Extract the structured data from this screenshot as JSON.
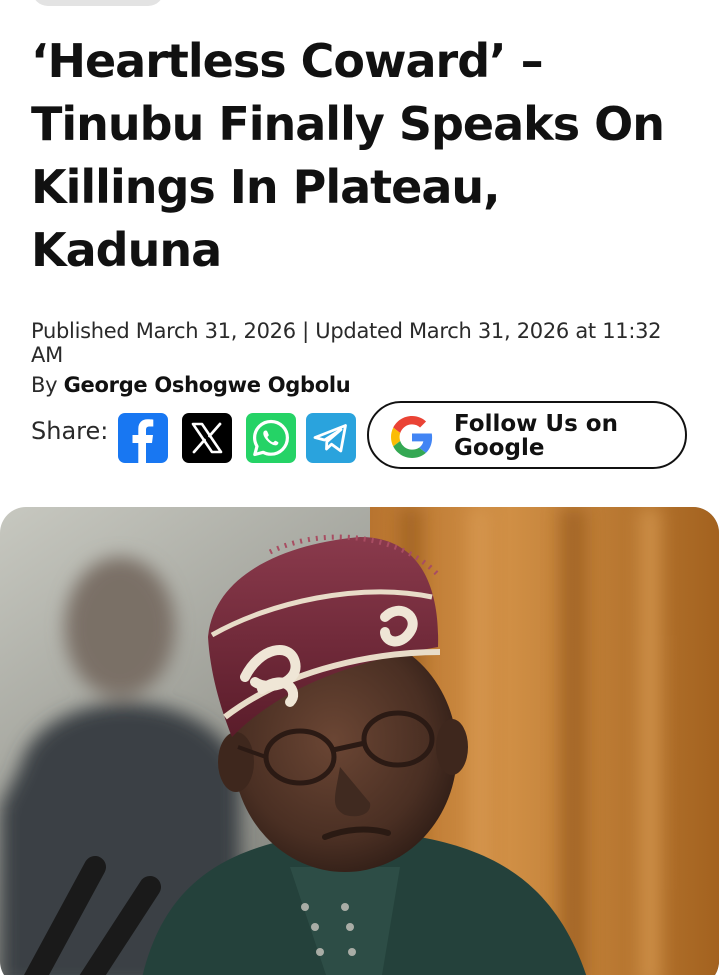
{
  "article": {
    "headline": "‘Heartless Coward’ – Tinubu Finally Speaks On Killings In Plateau, Kaduna",
    "published_line": "Published March 31, 2026 | Updated March 31, 2026 at 11:32 AM",
    "byline_prefix": "By ",
    "author": "George Oshogwe Ogbolu"
  },
  "share": {
    "label": "Share:",
    "networks": [
      {
        "name": "facebook",
        "icon": "facebook-icon",
        "color": "#1877f2"
      },
      {
        "name": "x",
        "icon": "x-icon",
        "color": "#000000"
      },
      {
        "name": "whatsapp",
        "icon": "whatsapp-icon",
        "color": "#25d366"
      },
      {
        "name": "telegram",
        "icon": "telegram-icon",
        "color": "#2aa3dd"
      }
    ]
  },
  "follow": {
    "label": "Follow Us on Google",
    "icon": "google-icon"
  },
  "image": {
    "subject": "photo-of-man-in-maroon-cap"
  },
  "colors": {
    "text": "#111111",
    "meta": "#2a2a2a",
    "facebook": "#1877f2",
    "whatsapp": "#25d366",
    "telegram": "#2aa3dd"
  }
}
